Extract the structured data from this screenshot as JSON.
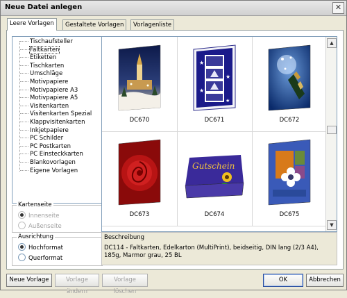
{
  "window": {
    "title": "Neue Datei anlegen",
    "close_glyph": "✕"
  },
  "tabs": [
    {
      "label": "Leere Vorlagen",
      "active": true
    },
    {
      "label": "Gestaltete Vorlagen",
      "active": false
    },
    {
      "label": "Vorlagenliste",
      "active": false
    }
  ],
  "tree": {
    "items": [
      "Tischaufsteller",
      "Faltkarten",
      "Etiketten",
      "Tischkarten",
      "Umschläge",
      "Motivpapiere",
      "Motivpapiere A3",
      "Motivpapiere A5",
      "Visitenkarten",
      "Visitenkarten Spezial",
      "Klappvisitenkarten",
      "Inkjetpapiere",
      "PC Schilder",
      "PC Postkarten",
      "PC Einsteckkarten",
      "Blankovorlagen",
      "Eigene Vorlagen"
    ],
    "selected": "Faltkarten"
  },
  "kartenseite": {
    "legend": "Kartenseite",
    "options": [
      {
        "label": "Innenseite",
        "checked": true,
        "disabled": true
      },
      {
        "label": "Außenseite",
        "checked": false,
        "disabled": true
      }
    ]
  },
  "ausrichtung": {
    "legend": "Ausrichtung",
    "options": [
      {
        "label": "Hochformat",
        "checked": true,
        "disabled": false
      },
      {
        "label": "Querformat",
        "checked": false,
        "disabled": false
      }
    ]
  },
  "templates": [
    {
      "code": "DC670",
      "motif": "winter-church"
    },
    {
      "code": "DC671",
      "motif": "blue-christmas-tree"
    },
    {
      "code": "DC672",
      "motif": "champagne"
    },
    {
      "code": "DC673",
      "motif": "red-rose"
    },
    {
      "code": "DC674",
      "motif": "gutschein",
      "card_text": "Gutschein"
    },
    {
      "code": "DC675",
      "motif": "flower-blue"
    }
  ],
  "scrollbar": {
    "up_glyph": "▲",
    "down_glyph": "▼"
  },
  "beschreibung": {
    "label": "Beschreibung",
    "text": "DC114 - Faltkarten, Edelkarton (MultiPrint), beidseitig, DIN lang (2/3 A4), 185g, Marmor grau, 25 BL"
  },
  "buttons": {
    "neue_vorlage": "Neue Vorlage",
    "vorlage_aendern": "Vorlage ändern",
    "vorlage_loeschen": "Vorlage löschen",
    "ok": "OK",
    "abbrechen": "Abbrechen"
  }
}
